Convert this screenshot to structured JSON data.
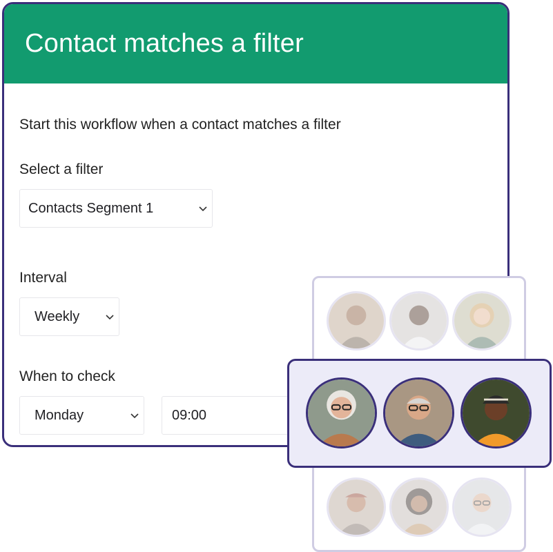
{
  "header": {
    "title": "Contact matches a filter"
  },
  "description": "Start this workflow when a contact matches a filter",
  "filter": {
    "label": "Select a filter",
    "value": "Contacts Segment 1"
  },
  "interval": {
    "label": "Interval",
    "value": "Weekly"
  },
  "when_to_check": {
    "label": "When to check",
    "day": "Monday",
    "time": "09:00"
  },
  "colors": {
    "header_bg": "#129b6f",
    "border": "#3a2f7a",
    "highlight_bg": "#ecebf8"
  },
  "people": {
    "faded_top": [
      "person-1",
      "person-2",
      "person-3"
    ],
    "highlighted": [
      "person-4",
      "person-5",
      "person-6"
    ],
    "faded_bottom": [
      "person-7",
      "person-8",
      "person-9"
    ]
  }
}
